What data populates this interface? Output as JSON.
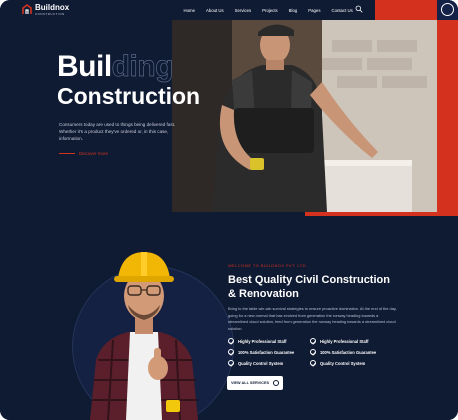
{
  "brand": {
    "name": "Buildnox",
    "tagline": "CONSTRUCTION"
  },
  "nav": {
    "items": [
      "Home",
      "About Us",
      "Services",
      "Projects",
      "Blog",
      "Pages",
      "Contact Us"
    ]
  },
  "hero": {
    "title_solid": "Buil",
    "title_outline": "ding",
    "title_line2": "Construction",
    "text": "Consumers today are used to things being delivered fast. Whether it's a product they've ordered or, in this case, information.",
    "link": "Discover more"
  },
  "about": {
    "eyebrow": "WELCOME TO BUILDNOX PVT. LTD.",
    "title": "Best Quality Civil Construction & Renovation",
    "text": "Bring to the table win-win survival strategies to ensure proactive domination. At the end of the day, going for a new normal that has evolved from generation the runway heading towards a streamlined cloud solution, feed from generation the runway heading towards a streamlined cloud solution.",
    "features": [
      "Highly Professional Staff",
      "Highly Professional Staff",
      "100% Satisfaction Guarantee",
      "100% Satisfaction Guarantee",
      "Quality Control System",
      "Quality Control System"
    ],
    "button": "VIEW ALL SERVICES"
  },
  "colors": {
    "navy": "#0f1a33",
    "accent": "#d4321f",
    "helmet": "#f2b705"
  },
  "icons": [
    "logo-icon",
    "search-icon",
    "menu-circle-icon",
    "check-circle-icon",
    "arrow-right-icon"
  ]
}
